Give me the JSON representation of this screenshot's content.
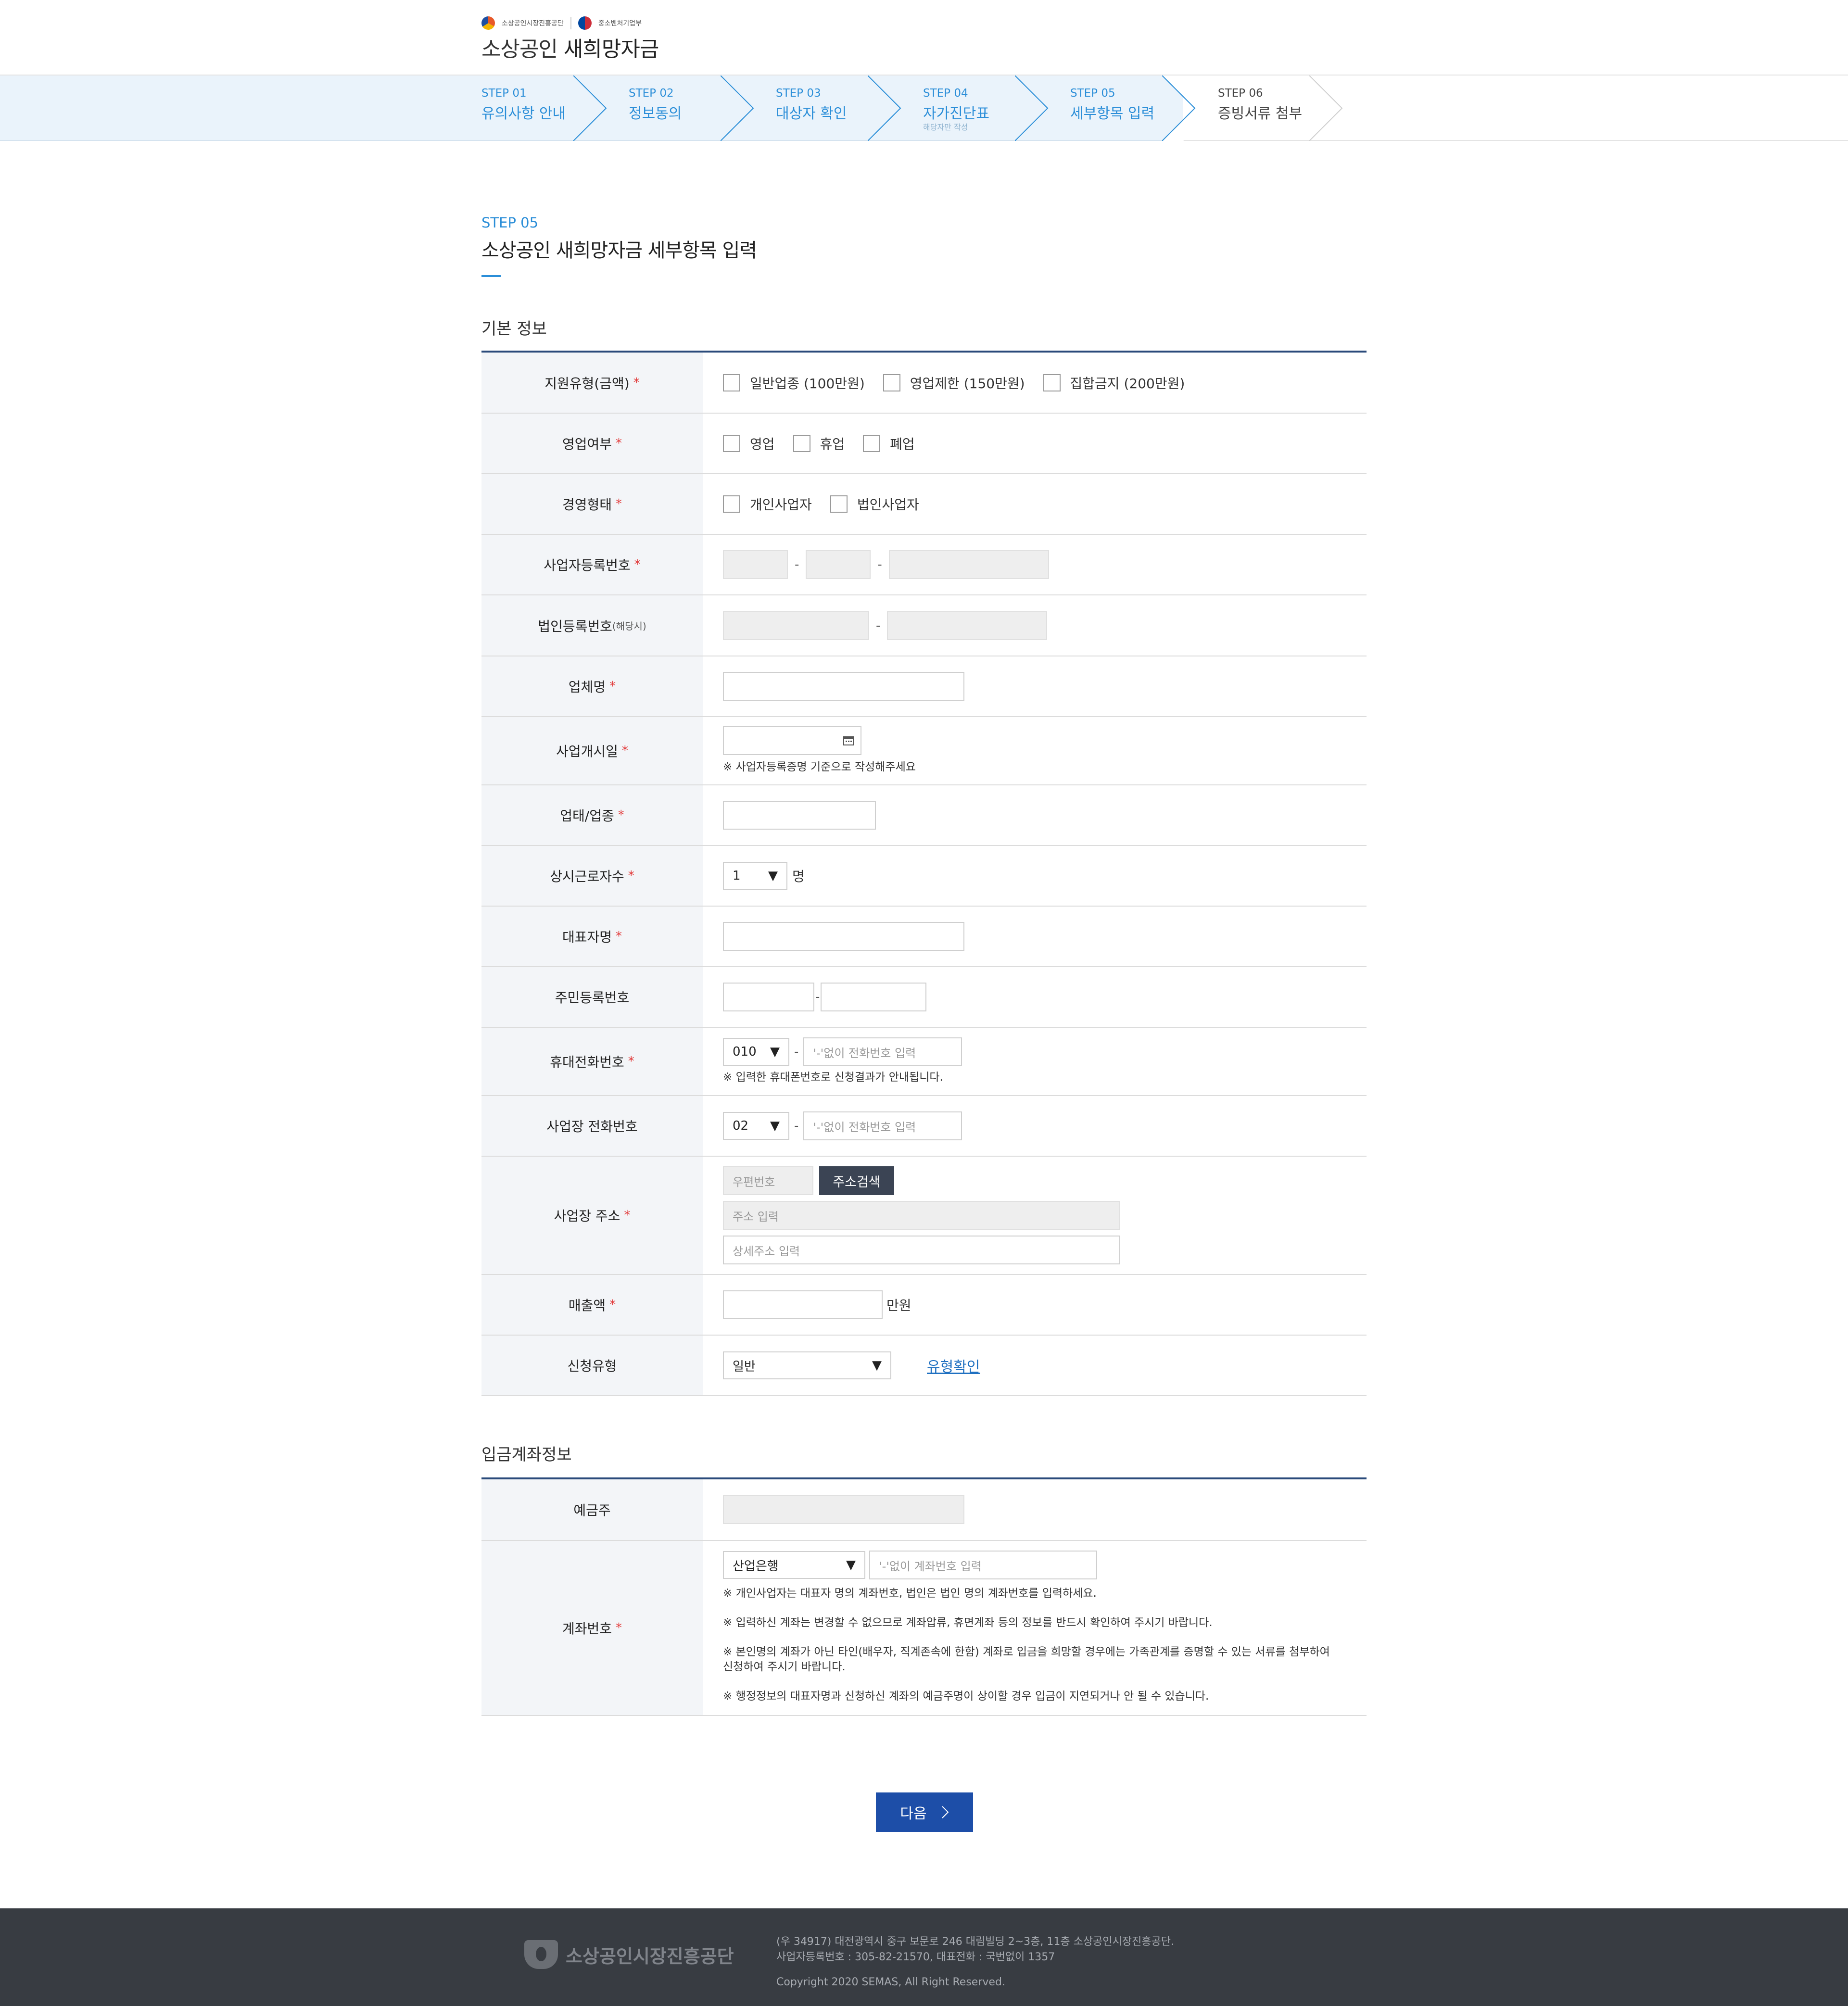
{
  "header": {
    "org1": "소상공인시장진흥공단",
    "org2": "중소벤처기업부",
    "title_prefix": "소상공인",
    "title_main": "새희망자금"
  },
  "steps": [
    {
      "label": "STEP 01",
      "name": "유의사항 안내",
      "sub": ""
    },
    {
      "label": "STEP 02",
      "name": "정보동의",
      "sub": ""
    },
    {
      "label": "STEP 03",
      "name": "대상자 확인",
      "sub": ""
    },
    {
      "label": "STEP 04",
      "name": "자가진단표",
      "sub": "해당자만 작성"
    },
    {
      "label": "STEP 05",
      "name": "세부항목 입력",
      "sub": ""
    },
    {
      "label": "STEP 06",
      "name": "증빙서류 첨부",
      "sub": ""
    }
  ],
  "page": {
    "step": "STEP 05",
    "title": "소상공인 새희망자금 세부항목 입력"
  },
  "basic": {
    "section_title": "기본 정보",
    "required_mark": "*",
    "support_type": {
      "label": "지원유형(금액)",
      "options": [
        "일반업종 (100만원)",
        "영업제한 (150만원)",
        "집합금지 (200만원)"
      ]
    },
    "business_status": {
      "label": "영업여부",
      "options": [
        "영업",
        "휴업",
        "폐업"
      ]
    },
    "management_type": {
      "label": "경영형태",
      "options": [
        "개인사업자",
        "법인사업자"
      ]
    },
    "biz_reg_no": {
      "label": "사업자등록번호",
      "sep": "-"
    },
    "corp_reg_no": {
      "label": "법인등록번호",
      "label_small": "(해당시)",
      "sep": "-"
    },
    "company_name": {
      "label": "업체명"
    },
    "start_date": {
      "label": "사업개시일",
      "note": "※ 사업자등록증명 기준으로 작성해주세요"
    },
    "industry": {
      "label": "업태/업종"
    },
    "employees": {
      "label": "상시근로자수",
      "value": "1",
      "unit": "명"
    },
    "ceo_name": {
      "label": "대표자명"
    },
    "resident_no": {
      "label": "주민등록번호",
      "sep": "-"
    },
    "mobile": {
      "label": "휴대전화번호",
      "prefix": "010",
      "sep": "-",
      "placeholder": "'-'없이 전화번호 입력",
      "note": "※ 입력한 휴대폰번호로 신청결과가 안내됩니다."
    },
    "biz_phone": {
      "label": "사업장 전화번호",
      "prefix": "02",
      "sep": "-",
      "placeholder": "'-'없이 전화번호 입력"
    },
    "address": {
      "label": "사업장 주소",
      "zip_placeholder": "우편번호",
      "search_button": "주소검색",
      "addr_placeholder": "주소 입력",
      "detail_placeholder": "상세주소 입력"
    },
    "sales": {
      "label": "매출액",
      "unit": "만원"
    },
    "apply_type": {
      "label": "신청유형",
      "value": "일반",
      "link": "유형확인"
    }
  },
  "account": {
    "section_title": "입금계좌정보",
    "holder": {
      "label": "예금주"
    },
    "number": {
      "label": "계좌번호",
      "bank": "산업은행",
      "placeholder": "'-'없이 계좌번호 입력",
      "notes": [
        "※ 개인사업자는 대표자 명의 계좌번호, 법인은 법인 명의 계좌번호를 입력하세요.",
        "※ 입력하신 계좌는 변경할 수 없으므로 계좌압류, 휴면계좌 등의 정보를 반드시 확인하여 주시기 바랍니다.",
        "※ 본인명의 계좌가 아닌 타인(배우자, 직계존속에 한함) 계좌로 입금을 희망할 경우에는 가족관계를 증명할 수 있는 서류를 첨부하여 신청하여 주시기 바랍니다.",
        "※ 행정정보의 대표자명과 신청하신 계좌의 예금주명이 상이할 경우 입금이 지연되거나 안 될 수 있습니다."
      ]
    }
  },
  "next_button": "다음",
  "footer": {
    "logo_text": "소상공인시장진흥공단",
    "address": "(우 34917) 대전광역시 중구 보문로 246 대림빌딩 2~3층, 11층 소상공인시장진흥공단.",
    "biz_info": "사업자등록번호 : 305-82-21570, 대표전화 : 국번없이 1357",
    "copyright": "Copyright 2020 SEMAS, All Right Reserved."
  },
  "colors": {
    "accent": "#2b8ed8",
    "table_border": "#2a4a7a",
    "next_button": "#1d4ea8",
    "footer_bg": "#383c42",
    "required": "#e23b3b"
  },
  "icons": [
    "calendar-icon",
    "dropdown-arrow-icon",
    "chevron-right-icon",
    "semas-logo-icon"
  ]
}
